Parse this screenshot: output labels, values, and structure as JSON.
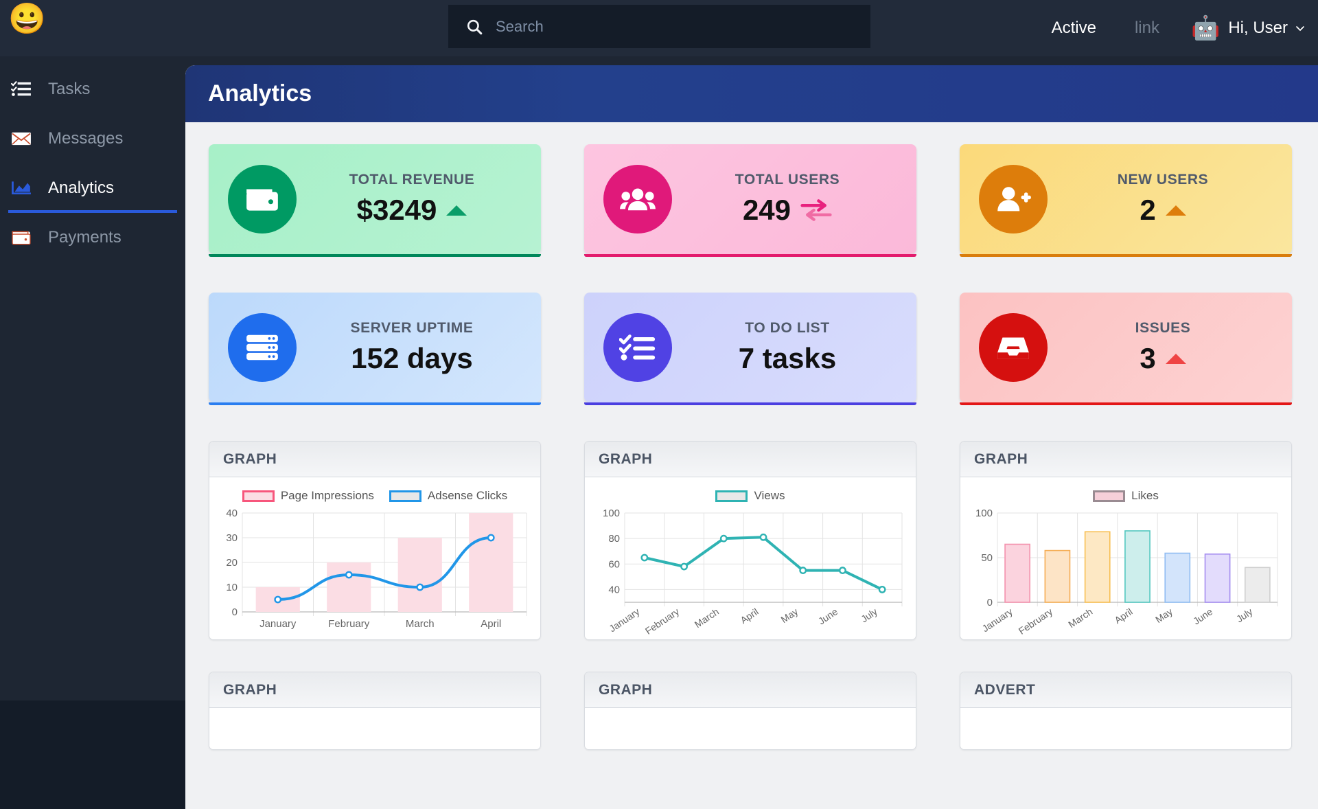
{
  "topbar": {
    "logo_icon": "grinning-face-emoji",
    "logo_glyph": "😀",
    "search": {
      "placeholder": "Search",
      "value": "",
      "icon": "search-icon"
    },
    "links": [
      {
        "label": "Active",
        "state": "active"
      },
      {
        "label": "link",
        "state": "muted"
      }
    ],
    "avatar_icon": "robot-avatar",
    "avatar_glyph": "🤖",
    "greeting": "Hi, User",
    "chevron_icon": "chevron-down-icon"
  },
  "sidebar": {
    "items": [
      {
        "label": "Tasks",
        "icon": "tasks-list-icon",
        "active": false
      },
      {
        "label": "Messages",
        "icon": "envelope-icon",
        "active": false
      },
      {
        "label": "Analytics",
        "icon": "bar-chart-icon",
        "active": true
      },
      {
        "label": "Payments",
        "icon": "wallet-icon",
        "active": false
      }
    ]
  },
  "page": {
    "title": "Analytics"
  },
  "stat_cards": [
    {
      "label": "TOTAL REVENUE",
      "value": "$3249",
      "icon": "wallet-icon",
      "theme": "c-green",
      "indicator": "up-triangle",
      "indicator_color": "#0b9d69"
    },
    {
      "label": "TOTAL USERS",
      "value": "249",
      "icon": "users-group-icon",
      "theme": "c-pink",
      "indicator": "exchange-arrows",
      "indicator_color": "#e8217e"
    },
    {
      "label": "NEW USERS",
      "value": "2",
      "icon": "user-plus-icon",
      "theme": "c-yellow",
      "indicator": "up-triangle",
      "indicator_color": "#dd7d0b"
    },
    {
      "label": "SERVER UPTIME",
      "value": "152 days",
      "icon": "server-icon",
      "theme": "c-blue",
      "indicator": "none",
      "indicator_color": ""
    },
    {
      "label": "TO DO LIST",
      "value": "7 tasks",
      "icon": "checklist-icon",
      "theme": "c-indigo",
      "indicator": "none",
      "indicator_color": ""
    },
    {
      "label": "ISSUES",
      "value": "3",
      "icon": "inbox-icon",
      "theme": "c-red",
      "indicator": "up-triangle",
      "indicator_color": "#ef4444"
    }
  ],
  "panels": [
    {
      "title": "GRAPH"
    },
    {
      "title": "GRAPH"
    },
    {
      "title": "GRAPH"
    },
    {
      "title": "GRAPH"
    },
    {
      "title": "GRAPH"
    },
    {
      "title": "ADVERT"
    }
  ],
  "chart_data": [
    {
      "type": "bar",
      "title": "",
      "categories": [
        "January",
        "February",
        "March",
        "April"
      ],
      "series": [
        {
          "name": "Page Impressions",
          "type": "bar",
          "values": [
            10,
            20,
            30,
            40
          ],
          "fill": "#fbdde4",
          "stroke": "#f7567c"
        },
        {
          "name": "Adsense Clicks",
          "type": "line",
          "values": [
            5,
            15,
            10,
            30
          ],
          "fill": "#e8e8e8",
          "stroke": "#2196e8"
        }
      ],
      "yticks": [
        0,
        10,
        20,
        30,
        40
      ],
      "ylim": [
        0,
        40
      ],
      "xlabel": "",
      "ylabel": "",
      "grid": true,
      "legend_position": "top"
    },
    {
      "type": "line",
      "title": "",
      "categories": [
        "January",
        "February",
        "March",
        "April",
        "May",
        "June",
        "July"
      ],
      "series": [
        {
          "name": "Views",
          "type": "line",
          "values": [
            65,
            58,
            80,
            81,
            55,
            55,
            40
          ],
          "fill": "#e8e8e8",
          "stroke": "#2fb3b3"
        }
      ],
      "yticks": [
        40,
        60,
        80,
        100
      ],
      "ylim": [
        30,
        100
      ],
      "xlabel": "",
      "ylabel": "",
      "grid": true,
      "legend_position": "top"
    },
    {
      "type": "bar",
      "title": "",
      "categories": [
        "January",
        "February",
        "March",
        "April",
        "May",
        "June",
        "July"
      ],
      "series": [
        {
          "name": "Likes",
          "type": "bar",
          "values": [
            65,
            58,
            79,
            80,
            55,
            54,
            39
          ],
          "fill": "#f6cfd9",
          "stroke": "#9a8b92",
          "bar_fills": [
            "#fbd3de",
            "#fde4c6",
            "#fde8c4",
            "#cdeeec",
            "#d3e4fb",
            "#e3dcfc",
            "#ececec"
          ],
          "bar_strokes": [
            "#f391ad",
            "#f5ad54",
            "#f8bf52",
            "#53c7c0",
            "#8fbcf2",
            "#a48cf0",
            "#cfcfcf"
          ]
        }
      ],
      "yticks": [
        0,
        50,
        100
      ],
      "ylim": [
        0,
        100
      ],
      "xlabel": "",
      "ylabel": "",
      "grid": true,
      "legend_position": "top"
    }
  ]
}
